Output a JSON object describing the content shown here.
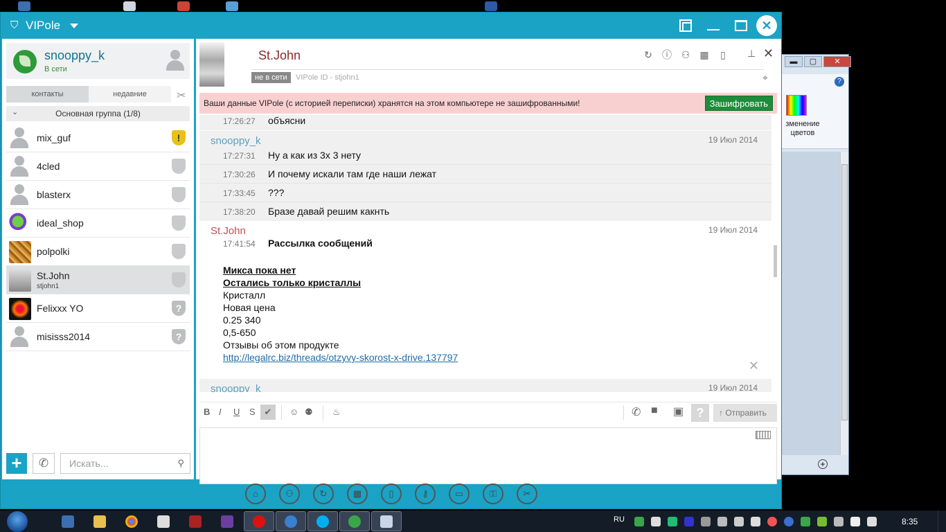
{
  "app": {
    "title": "VIPole"
  },
  "profile": {
    "nick": "snooppy_k",
    "status": "В сети"
  },
  "left_tabs": [
    "контакты",
    "недавние"
  ],
  "group": {
    "label": "Основная группа (1/8)"
  },
  "contacts": [
    {
      "name": "mix_guf",
      "sub": "",
      "shield": "!"
    },
    {
      "name": "4cled",
      "sub": "",
      "shield": ""
    },
    {
      "name": "blasterx",
      "sub": "",
      "shield": ""
    },
    {
      "name": "ideal_shop",
      "sub": "",
      "shield": ""
    },
    {
      "name": "polpolki",
      "sub": "",
      "shield": ""
    },
    {
      "name": "St.John",
      "sub": "stjohn1",
      "shield": ""
    },
    {
      "name": "Felixxx YO",
      "sub": "",
      "shield": "?"
    },
    {
      "name": "misisss2014",
      "sub": "",
      "shield": "?"
    }
  ],
  "search": {
    "placeholder": "Искать..."
  },
  "chat": {
    "name": "St.John",
    "status_badge": "не в сети",
    "vipole_id": "VIPole ID - stjohn1"
  },
  "warning": {
    "text": "Ваши данные VIPole (с историей переписки) хранятся на этом компьютере не зашифрованными!",
    "button": "Зашифровать"
  },
  "messages": {
    "top": {
      "time": "17:26:27",
      "text": "объясни"
    },
    "block1": {
      "sender": "snooppy_k",
      "date": "19 Июл 2014",
      "rows": [
        {
          "time": "17:27:31",
          "text": "Ну а как из 3х 3 нету"
        },
        {
          "time": "17:30:26",
          "text": "И почему искали там где наши лежат"
        },
        {
          "time": "17:33:45",
          "text": "???"
        },
        {
          "time": "17:38:20",
          "text": "Бразе давай решим какнть"
        }
      ]
    },
    "block2": {
      "sender": "St.John",
      "date": "19 Июл 2014",
      "time": "17:41:54",
      "title": "Рассылка сообщений",
      "lines": [
        {
          "text": "Микса пока нет",
          "style": "ul"
        },
        {
          "text": "Остались только кристаллы",
          "style": "ul"
        },
        {
          "text": "Кристалл",
          "style": ""
        },
        {
          "text": "Новая цена",
          "style": ""
        },
        {
          "text": "0.25 340",
          "style": ""
        },
        {
          "text": "0,5-650",
          "style": ""
        },
        {
          "text": "Отзывы об этом продукте",
          "style": ""
        },
        {
          "text": "http://legalrc.biz/threads/otzyvy-skorost-x-drive.137797",
          "style": "link"
        }
      ]
    },
    "block3": {
      "sender": "snooppy_k",
      "date": "19 Июл 2014"
    }
  },
  "composer": {
    "format": [
      "B",
      "I",
      "U",
      "S"
    ],
    "send_label": "Отправить"
  },
  "paint": {
    "ribbon_label": "зменение цветов"
  },
  "taskbar": {
    "lang": "RU",
    "clock": "8:35"
  },
  "colors": {
    "accent": "#1aa3c5",
    "online": "#3b8c3b",
    "warning_bg": "#f9d0d0",
    "encrypt_button": "#1e8c3a",
    "sender_self": "#5a9fbf",
    "sender_other": "#c05050"
  }
}
